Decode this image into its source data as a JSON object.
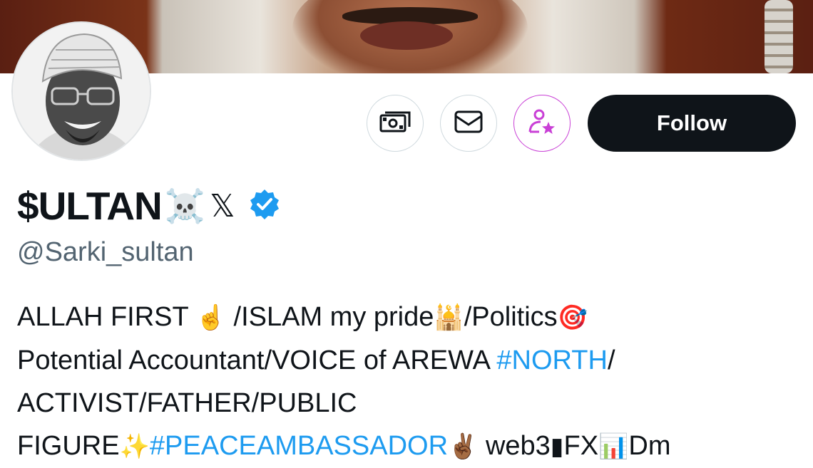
{
  "profile": {
    "display_name": "$ULTAN",
    "name_emoji": "☠️",
    "name_x_glyph": "𝕏",
    "handle": "@Sarki_sultan",
    "verified": true
  },
  "actions": {
    "tip_icon": "money-icon",
    "message_icon": "mail-icon",
    "subscribe_icon": "person-star-icon",
    "follow_label": "Follow"
  },
  "bio": {
    "l1_a": "ALLAH FIRST ",
    "l1_e1": "☝️",
    "l1_b": " /ISLAM my pride",
    "l1_e2": "🕌",
    "l1_c": "/Politics",
    "l1_e3": "🎯",
    "l2_a": "Potential Accountant/VOICE of AREWA ",
    "l2_tag": "#NORTH",
    "l2_b": "/",
    "l3": "ACTIVIST/FATHER/PUBLIC",
    "l4_a": "FIGURE",
    "l4_e1": "✨",
    "l4_tag": "#PEACEAMBASSADOR",
    "l4_e2": "✌🏾",
    "l4_b": " web3",
    "l4_e3": "▮",
    "l4_c": "FX",
    "l4_e4": "📊",
    "l4_d": "Dm"
  },
  "colors": {
    "text": "#0f1419",
    "secondary": "#536471",
    "link": "#1d9bf0",
    "follow_bg": "#0f1419",
    "subscribe_accent": "#c940d6",
    "verified_badge": "#1d9bf0"
  }
}
